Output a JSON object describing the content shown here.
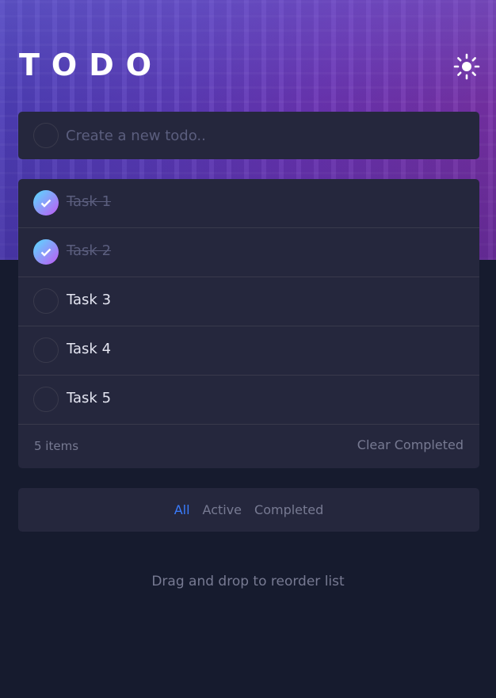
{
  "header": {
    "title": "TODO",
    "theme_icon": "sun-icon"
  },
  "new_todo": {
    "placeholder": "Create a new todo.."
  },
  "todos": [
    {
      "text": "Task 1",
      "completed": true
    },
    {
      "text": "Task 2",
      "completed": true
    },
    {
      "text": "Task 3",
      "completed": false
    },
    {
      "text": "Task 4",
      "completed": false
    },
    {
      "text": "Task 5",
      "completed": false
    }
  ],
  "footer": {
    "items_left": "5 items",
    "clear_label": "Clear Completed"
  },
  "filters": [
    {
      "label": "All",
      "active": true
    },
    {
      "label": "Active",
      "active": false
    },
    {
      "label": "Completed",
      "active": false
    }
  ],
  "hint": "Drag and drop to reorder list",
  "colors": {
    "accent": "#3a7cfd",
    "check_gradient_start": "#57ddff",
    "check_gradient_end": "#c058f3",
    "card": "#25273d",
    "background": "#161b2e"
  }
}
